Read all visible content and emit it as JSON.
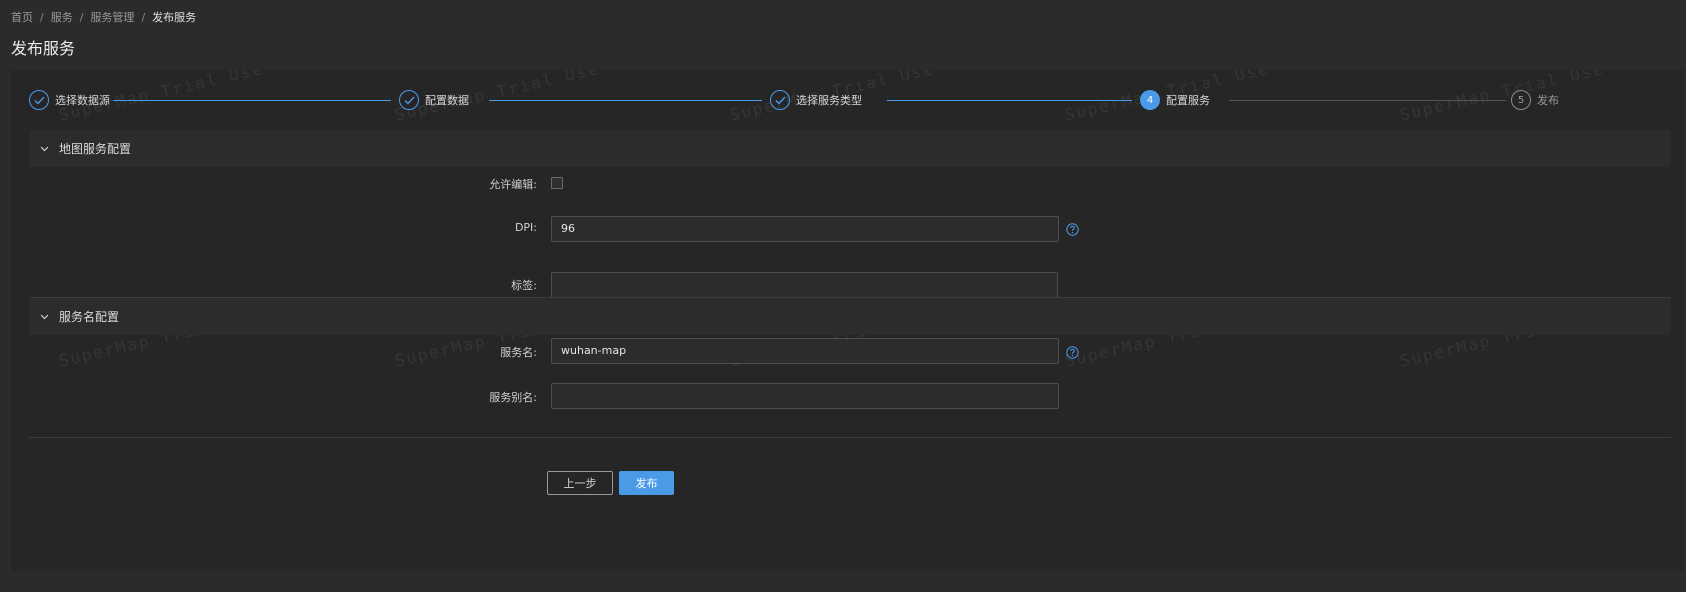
{
  "breadcrumb": {
    "items": [
      "首页",
      "服务",
      "服务管理"
    ],
    "current": "发布服务",
    "separator": "/"
  },
  "page": {
    "title": "发布服务"
  },
  "steps": [
    {
      "label": "选择数据源",
      "status": "done"
    },
    {
      "label": "配置数据",
      "status": "done"
    },
    {
      "label": "选择服务类型",
      "status": "done"
    },
    {
      "label": "配置服务",
      "status": "active",
      "number": "4"
    },
    {
      "label": "发布",
      "status": "pending",
      "number": "5"
    }
  ],
  "map_config": {
    "title": "地图服务配置",
    "allow_edit_label": "允许编辑:",
    "allow_edit_checked": false,
    "dpi_label": "DPI:",
    "dpi_value": "96",
    "tags_label": "标签:",
    "tags_value": ""
  },
  "name_config": {
    "title": "服务名配置",
    "name_label": "服务名:",
    "name_value": "wuhan-map",
    "alias_label": "服务别名:",
    "alias_value": ""
  },
  "actions": {
    "prev_label": "上一步",
    "publish_label": "发布"
  },
  "watermark": {
    "text": "SuperMap Trial Use"
  },
  "colors": {
    "accent": "#4a9ae8",
    "background": "#2b2b2b",
    "card": "#262626"
  }
}
